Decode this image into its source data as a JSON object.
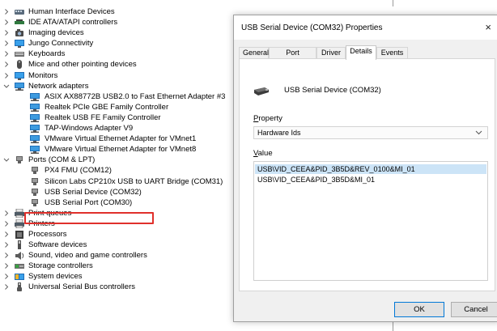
{
  "device_tree": {
    "items": [
      {
        "level": 0,
        "expanded": false,
        "label": "Human Interface Devices",
        "icon": "hid-icon"
      },
      {
        "level": 0,
        "expanded": false,
        "label": "IDE ATA/ATAPI controllers",
        "icon": "ide-icon"
      },
      {
        "level": 0,
        "expanded": false,
        "label": "Imaging devices",
        "icon": "camera-icon"
      },
      {
        "level": 0,
        "expanded": false,
        "label": "Jungo Connectivity",
        "icon": "monitor-icon"
      },
      {
        "level": 0,
        "expanded": false,
        "label": "Keyboards",
        "icon": "keyboard-icon"
      },
      {
        "level": 0,
        "expanded": false,
        "label": "Mice and other pointing devices",
        "icon": "mouse-icon"
      },
      {
        "level": 0,
        "expanded": false,
        "label": "Monitors",
        "icon": "monitor-icon"
      },
      {
        "level": 0,
        "expanded": true,
        "label": "Network adapters",
        "icon": "network-icon"
      },
      {
        "level": 1,
        "label": "ASIX AX88772B USB2.0 to Fast Ethernet Adapter #3",
        "icon": "network-icon"
      },
      {
        "level": 1,
        "label": "Realtek PCIe GBE Family Controller",
        "icon": "network-icon"
      },
      {
        "level": 1,
        "label": "Realtek USB FE Family Controller",
        "icon": "network-icon"
      },
      {
        "level": 1,
        "label": "TAP-Windows Adapter V9",
        "icon": "network-icon"
      },
      {
        "level": 1,
        "label": "VMware Virtual Ethernet Adapter for VMnet1",
        "icon": "network-icon"
      },
      {
        "level": 1,
        "label": "VMware Virtual Ethernet Adapter for VMnet8",
        "icon": "network-icon"
      },
      {
        "level": 0,
        "expanded": true,
        "label": "Ports (COM & LPT)",
        "icon": "port-icon"
      },
      {
        "level": 1,
        "label": "PX4 FMU (COM12)",
        "icon": "port-icon"
      },
      {
        "level": 1,
        "label": "Silicon Labs CP210x USB to UART Bridge (COM31)",
        "icon": "port-icon"
      },
      {
        "level": 1,
        "label": "USB Serial Device (COM32)",
        "icon": "port-icon",
        "highlighted": true
      },
      {
        "level": 1,
        "label": "USB Serial Port (COM30)",
        "icon": "port-icon"
      },
      {
        "level": 0,
        "expanded": false,
        "label": "Print queues",
        "icon": "printer-icon"
      },
      {
        "level": 0,
        "expanded": false,
        "label": "Printers",
        "icon": "printer-icon"
      },
      {
        "level": 0,
        "expanded": false,
        "label": "Processors",
        "icon": "processor-icon"
      },
      {
        "level": 0,
        "expanded": false,
        "label": "Software devices",
        "icon": "software-icon"
      },
      {
        "level": 0,
        "expanded": false,
        "label": "Sound, video and game controllers",
        "icon": "sound-icon"
      },
      {
        "level": 0,
        "expanded": false,
        "label": "Storage controllers",
        "icon": "storage-icon"
      },
      {
        "level": 0,
        "expanded": false,
        "label": "System devices",
        "icon": "system-icon"
      },
      {
        "level": 0,
        "expanded": false,
        "label": "Universal Serial Bus controllers",
        "icon": "usb-icon"
      }
    ]
  },
  "dialog": {
    "title": "USB Serial Device (COM32) Properties",
    "close_glyph": "×",
    "tabs": [
      "General",
      "Port Settings",
      "Driver",
      "Details",
      "Events"
    ],
    "active_tab": "Details",
    "device_name": "USB Serial Device (COM32)",
    "property_label_u": "P",
    "property_label_rest": "roperty",
    "property_value": "Hardware Ids",
    "value_label_u": "V",
    "value_label_rest": "alue",
    "values": [
      "USB\\VID_CEEA&PID_3B5D&REV_0100&MI_01",
      "USB\\VID_CEEA&PID_3B5D&MI_01"
    ],
    "ok_label": "OK",
    "cancel_label": "Cancel"
  },
  "colors": {
    "highlight_box": "#e0302b",
    "selection": "#cce4f7",
    "accent": "#0078d7"
  }
}
